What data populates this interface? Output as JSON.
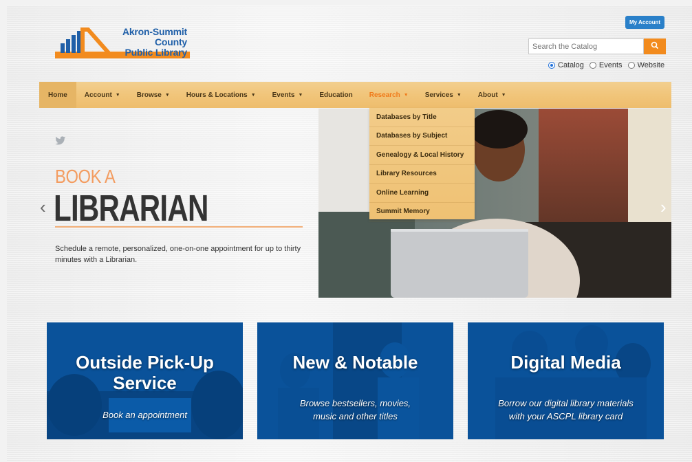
{
  "header": {
    "logo_line1": "Akron-Summit County",
    "logo_line2": "Public Library",
    "my_account": "My Account",
    "search_placeholder": "Search the Catalog",
    "radios": [
      {
        "label": "Catalog",
        "checked": true
      },
      {
        "label": "Events",
        "checked": false
      },
      {
        "label": "Website",
        "checked": false
      }
    ]
  },
  "nav": {
    "items": [
      "Home",
      "Account",
      "Browse",
      "Hours & Locations",
      "Events",
      "Education",
      "Research",
      "Services",
      "About"
    ],
    "active": "Research"
  },
  "research_dropdown": {
    "items": [
      "Databases by Title",
      "Databases by Subject",
      "Genealogy & Local History",
      "Library Resources",
      "Online Learning",
      "Summit Memory"
    ]
  },
  "hero": {
    "kicker": "BOOK A",
    "title": "LIBRARIAN",
    "description": "Schedule a remote, personalized, one-on-one appointment for up to thirty minutes with a Librarian."
  },
  "tiles": [
    {
      "title": "Outside Pick-Up Service",
      "title_l1": "Outside Pick-Up",
      "title_l2": "Service",
      "subtitle": "Book an appointment"
    },
    {
      "title": "New & Notable",
      "subtitle_l1": "Browse bestsellers, movies,",
      "subtitle_l2": "music and other titles"
    },
    {
      "title": "Digital Media",
      "subtitle_l1": "Borrow our digital library materials",
      "subtitle_l2": "with your ASCPL library card"
    }
  ],
  "colors": {
    "brand_blue": "#1f5fa8",
    "accent_orange": "#f28b1e",
    "nav_tan": "#f1c57a",
    "tile_blue": "#0a5aa8"
  }
}
